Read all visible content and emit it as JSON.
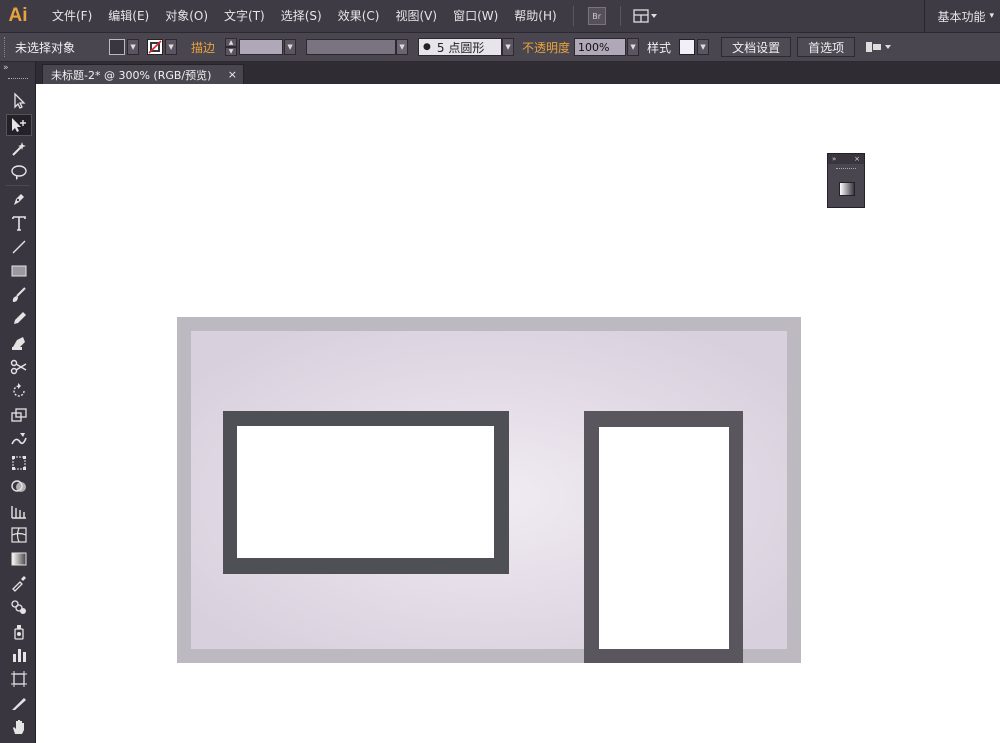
{
  "app": {
    "logo": "Ai"
  },
  "menu": [
    "文件(F)",
    "编辑(E)",
    "对象(O)",
    "文字(T)",
    "选择(S)",
    "效果(C)",
    "视图(V)",
    "窗口(W)",
    "帮助(H)"
  ],
  "menu_buttons": {
    "bridge": "Br"
  },
  "workspace": {
    "label": "基本功能",
    "arrow": "▾"
  },
  "control_bar": {
    "selection_status": "未选择对象",
    "stroke_label": "描边",
    "brush_dot": "●",
    "brush_value": "5 点圆形",
    "opacity_label": "不透明度",
    "opacity_value": "100%",
    "style_label": "样式",
    "doc_setup_button": "文档设置",
    "preferences_button": "首选项",
    "stroke_swatch_color": "#b0a8b8",
    "variable_width_color": "#7a7480",
    "style_swatch_color": "#f3eff7"
  },
  "document_tab": {
    "title": "未标题-2* @ 300% (RGB/预览)",
    "close": "×"
  },
  "toolbar": {
    "collapse": "»",
    "tools": [
      "selection-tool",
      "direct-selection-tool",
      "magic-wand-tool",
      "lasso-tool",
      "pen-tool",
      "type-tool",
      "line-segment-tool",
      "rectangle-tool",
      "paintbrush-tool",
      "pencil-tool",
      "blob-brush-tool",
      "scissors-tool",
      "rotate-tool",
      "scale-tool",
      "warp-tool",
      "free-transform-tool",
      "shape-builder-tool",
      "perspective-grid-tool",
      "mesh-tool",
      "gradient-tool",
      "eyedropper-tool",
      "blend-tool",
      "symbol-sprayer-tool",
      "column-graph-tool",
      "artboard-tool",
      "slice-tool",
      "hand-tool"
    ]
  },
  "float_panel": {
    "expand": "»",
    "close": "×"
  },
  "artwork": {
    "background_outer": "#bdb9c0",
    "background_inner_center": "#f1ebf3",
    "background_inner_edge": "#d8d0dc",
    "window_left_frame": "#4e5055",
    "window_right_frame": "#5a565e",
    "window_fill": "#ffffff"
  }
}
